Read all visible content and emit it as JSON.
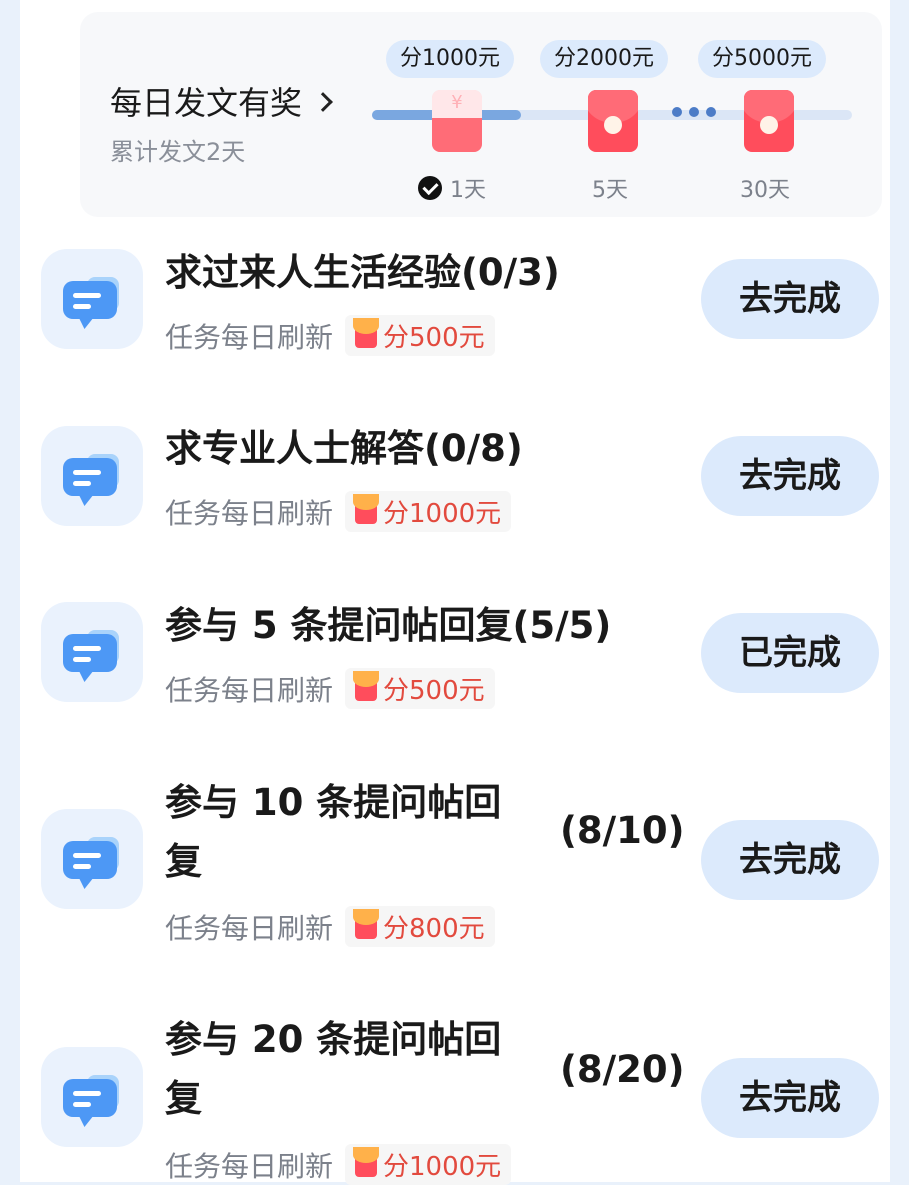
{
  "daily": {
    "title": "每日发文有奖",
    "subtitle": "累计发文2天",
    "progress_fraction": 0.31,
    "milestones": [
      {
        "reward": "分1000元",
        "day": "1天",
        "done": true
      },
      {
        "reward": "分2000元",
        "day": "5天",
        "done": false
      },
      {
        "reward": "分5000元",
        "day": "30天",
        "done": false
      }
    ]
  },
  "tasks": [
    {
      "title": "求过来人生活经验",
      "progress": "(0/3)",
      "refresh": "任务每日刷新",
      "reward": "分500元",
      "button": "去完成"
    },
    {
      "title": "求专业人士解答",
      "progress": "(0/8)",
      "refresh": "任务每日刷新",
      "reward": "分1000元",
      "button": "去完成"
    },
    {
      "title": "参与 5 条提问帖回复",
      "progress": "(5/5)",
      "refresh": "任务每日刷新",
      "reward": "分500元",
      "button": "已完成"
    },
    {
      "title_line1": "参与 10 条提问帖回",
      "title_line2": "复",
      "progress": "(8/10)",
      "refresh": "任务每日刷新",
      "reward": "分800元",
      "button": "去完成"
    },
    {
      "title_line1": "参与 20 条提问帖回",
      "title_line2": "复",
      "progress": "(8/20)",
      "refresh": "任务每日刷新",
      "reward": "分1000元",
      "button": "去完成"
    }
  ],
  "colors": {
    "accent_blue": "#4d98f5",
    "button_bg": "#dceafc",
    "reward_red": "#e24a3e",
    "envelope_red": "#ff4d5c"
  },
  "icons": {
    "task": "chat-bubble-icon",
    "reward": "red-envelope-icon",
    "check": "check-circle-icon",
    "chevron": "chevron-right-icon"
  }
}
